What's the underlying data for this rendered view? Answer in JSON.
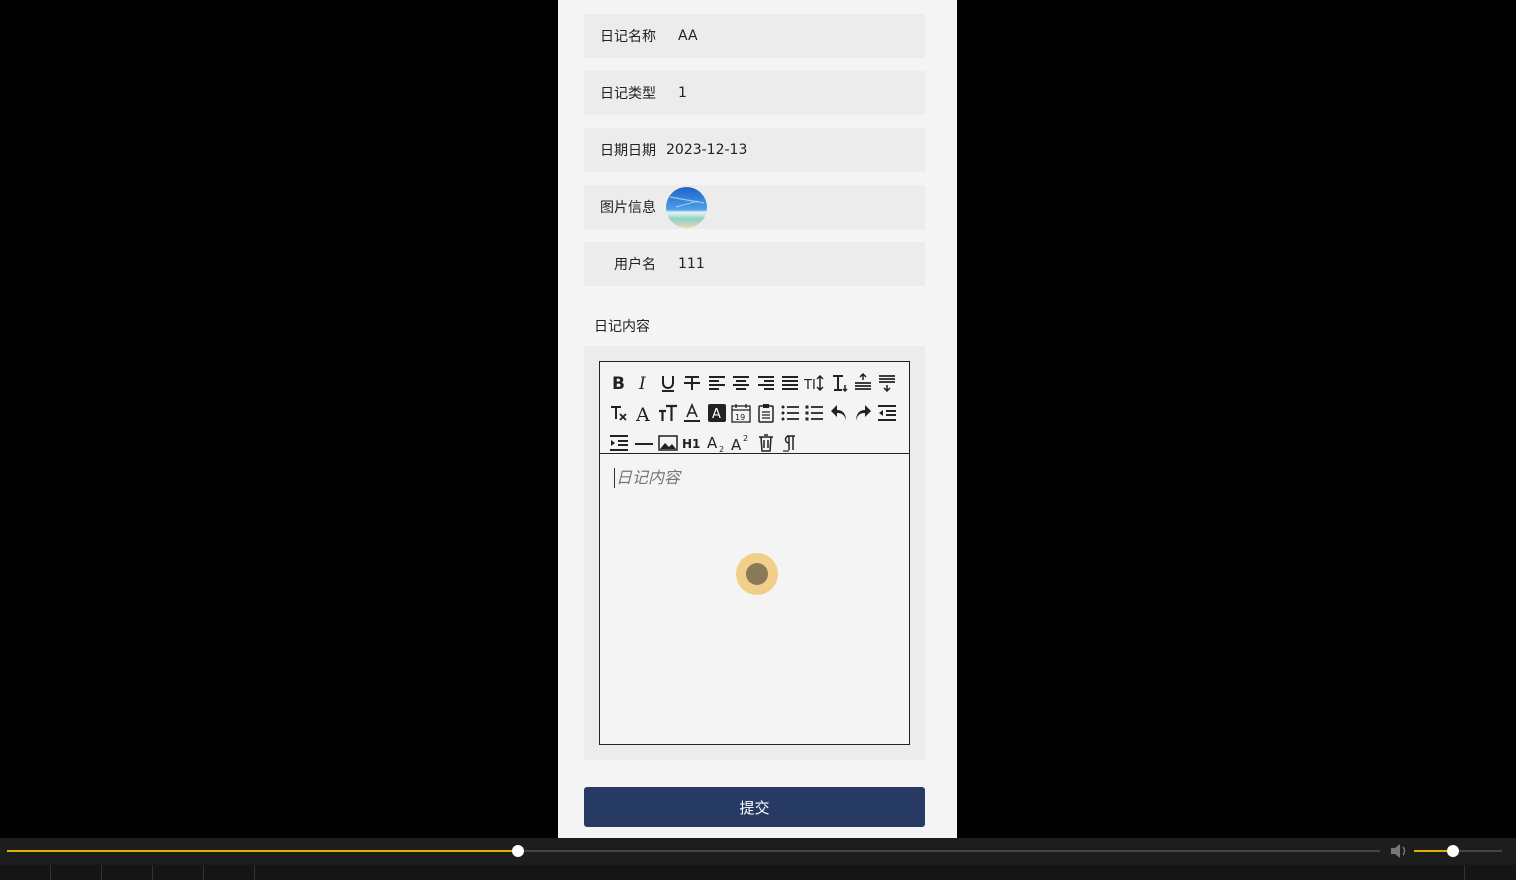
{
  "form": {
    "fields": [
      {
        "label": "日记名称",
        "value": "AA"
      },
      {
        "label": "日记类型",
        "value": "1"
      },
      {
        "label": "日期日期",
        "value": "2023-12-13"
      },
      {
        "label": "图片信息",
        "value": ""
      },
      {
        "label": "用户名",
        "value": "111"
      }
    ],
    "content_title": "日记内容",
    "content_placeholder": "日记内容",
    "submit_label": "提交"
  },
  "toolbar_icons": [
    "bold-icon",
    "italic-icon",
    "underline-icon",
    "strikethrough-icon",
    "align-left-icon",
    "align-center-icon",
    "align-right-icon",
    "align-justify-icon",
    "font-size-icon",
    "line-height-icon",
    "paragraph-spacing-top-icon",
    "paragraph-spacing-bottom-icon",
    "clear-format-icon",
    "font-family-icon",
    "text-size-icon",
    "font-color-icon",
    "background-color-icon",
    "date-icon",
    "paste-icon",
    "ordered-list-icon",
    "unordered-list-icon",
    "undo-icon",
    "redo-icon",
    "outdent-icon",
    "indent-icon",
    "horizontal-rule-icon",
    "image-icon",
    "heading-icon",
    "subscript-icon",
    "superscript-icon",
    "delete-icon",
    "paragraph-mark-icon"
  ],
  "player": {
    "progress": 0.372,
    "volume": 0.44,
    "accent": "#e0b100"
  }
}
